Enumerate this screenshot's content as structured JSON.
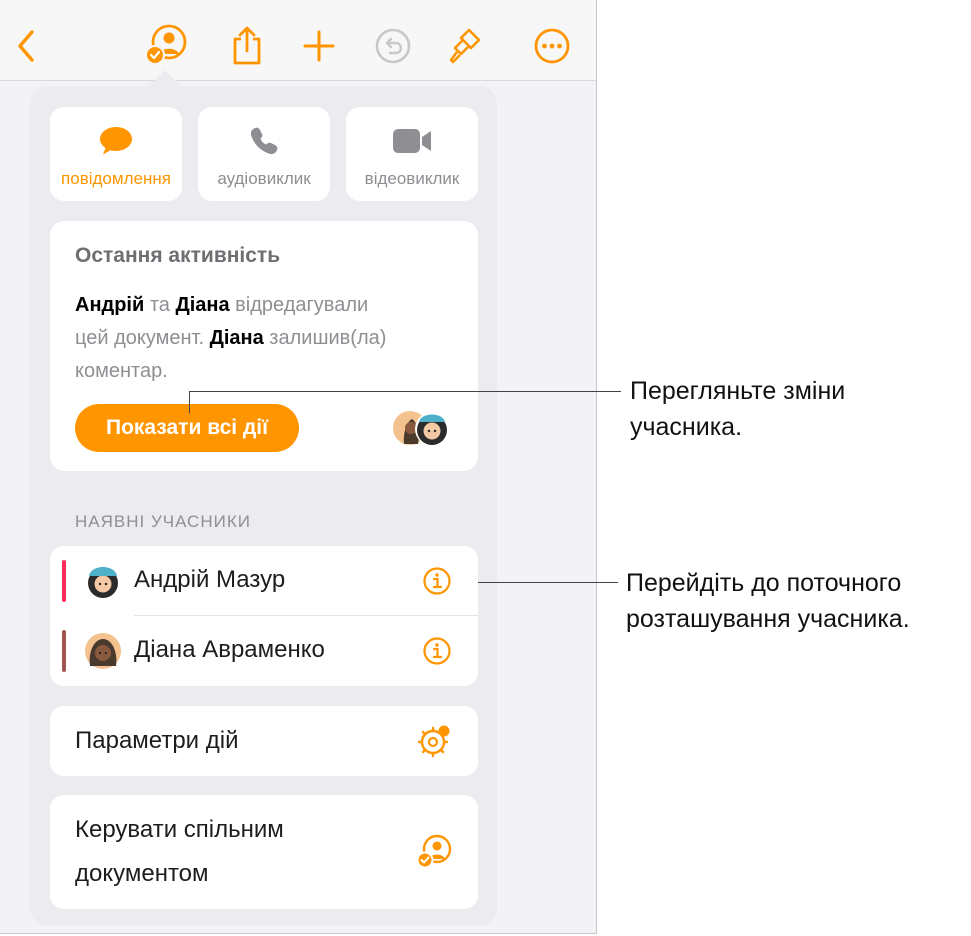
{
  "colors": {
    "accent": "#ff9500",
    "andrii_bar": "#ff2d55",
    "diana_bar": "#a2584e"
  },
  "toolbar": {
    "icons": [
      "back-chevron-icon",
      "collaborate-icon",
      "share-icon",
      "add-icon",
      "undo-icon",
      "format-brush-icon",
      "more-icon"
    ]
  },
  "communication": {
    "message": "повідомлення",
    "audio": "аудіовиклик",
    "video": "відеовиклик"
  },
  "activity": {
    "title": "Остання активність",
    "name1": "Андрій",
    "and": " та ",
    "name2": "Діана",
    "edited": " відредагували цей документ. ",
    "name3": "Діана",
    "commented": " залишив(ла) коментар.",
    "show_all": "Показати всі дії"
  },
  "participants": {
    "header": "НАЯВНІ УЧАСНИКИ",
    "items": [
      {
        "name": "Андрій Мазур"
      },
      {
        "name": "Діана Авраменко"
      }
    ]
  },
  "settings": {
    "label": "Параметри дій"
  },
  "manage": {
    "label": "Керувати спільним документом"
  },
  "callouts": {
    "first": "Перегляньте зміни учасника.",
    "second": "Перейдіть до поточного розташування учасника."
  }
}
